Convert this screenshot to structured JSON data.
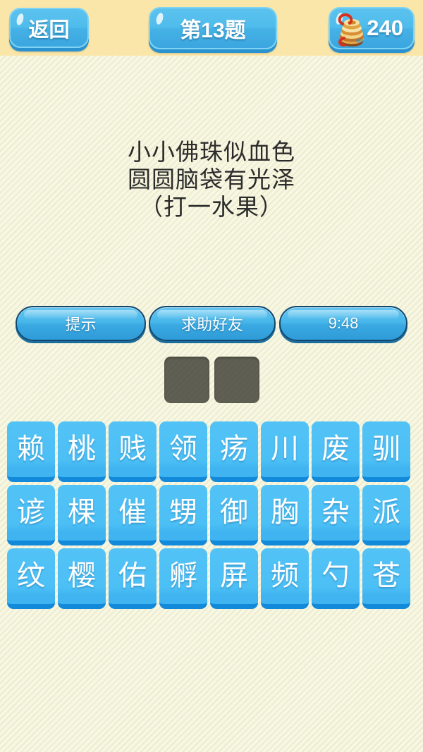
{
  "header": {
    "back_label": "返回",
    "level_label": "第13题",
    "coin_count": "240",
    "coin_icon": "coin-stack-icon",
    "band_color": "#f9e6a8",
    "button_color": "#4fbcec"
  },
  "riddle": {
    "line1": "小小佛珠似血色",
    "line2": "圆圆脑袋有光泽",
    "line3": "（打一水果）"
  },
  "actions": {
    "hint_label": "提示",
    "ask_friend_label": "求助好友",
    "timer_label": "9:48"
  },
  "answer": {
    "slot_count": 2,
    "slots": [
      "",
      ""
    ],
    "slot_color": "#38382f"
  },
  "tiles": {
    "rows": [
      [
        "赖",
        "桃",
        "贱",
        "领",
        "疡",
        "川",
        "废",
        "驯"
      ],
      [
        "谚",
        "棵",
        "催",
        "甥",
        "御",
        "胸",
        "杂",
        "派"
      ],
      [
        "纹",
        "樱",
        "佑",
        "孵",
        "屏",
        "频",
        "勺",
        "苍"
      ]
    ],
    "tile_color": "#4cbff5",
    "tile_edge_color": "#1389da"
  },
  "background": {
    "color": "#f7f7e3"
  }
}
